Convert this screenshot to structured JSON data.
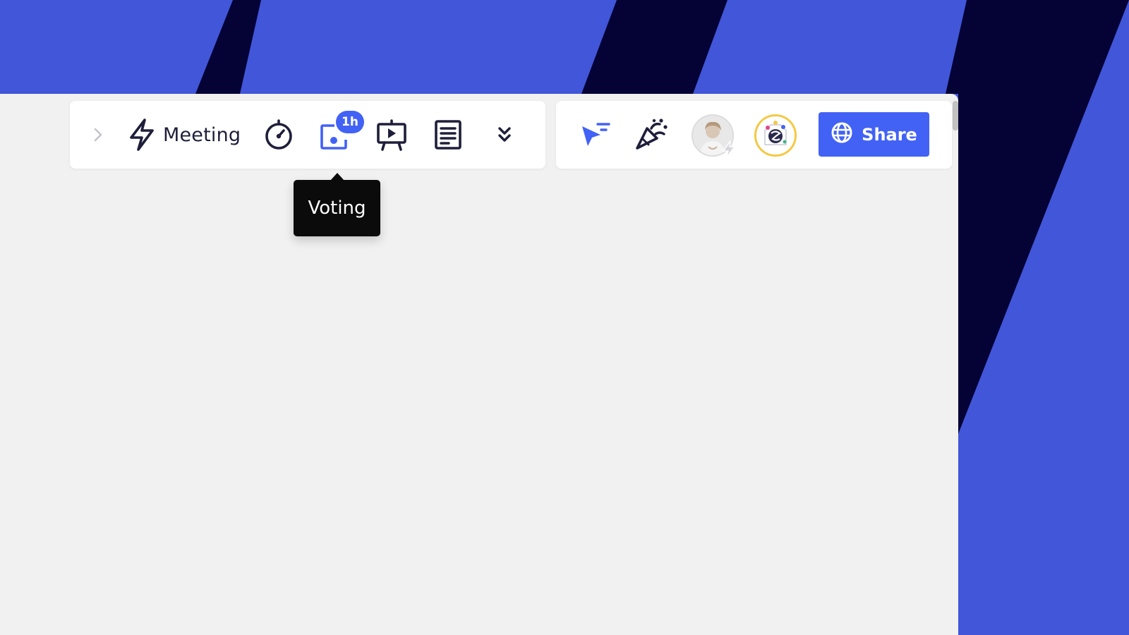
{
  "colors": {
    "background_blue": "#4256d9",
    "background_navy": "#050336",
    "canvas": "#f1f1f1",
    "accent": "#4262f5",
    "icon_dark": "#1f1e3a",
    "tooltip_bg": "#0b0b0b"
  },
  "toolbar_left": {
    "expand_icon": "chevron-right-icon",
    "meeting_icon": "lightning-icon",
    "meeting_label": "Meeting",
    "timer_icon": "stopwatch-icon",
    "voting_icon": "voting-icon",
    "voting_badge": "1h",
    "presentation_icon": "presentation-icon",
    "notes_icon": "notes-icon",
    "more_icon": "double-chevron-down-icon"
  },
  "tooltip": {
    "text": "Voting"
  },
  "toolbar_right": {
    "cursor_icon": "cursor-follow-icon",
    "reactions_icon": "confetti-icon",
    "avatars": [
      {
        "name": "user-avatar",
        "badge_icon": "lightning-icon"
      },
      {
        "name": "collaborator-avatar"
      }
    ],
    "share_icon": "globe-icon",
    "share_label": "Share"
  }
}
